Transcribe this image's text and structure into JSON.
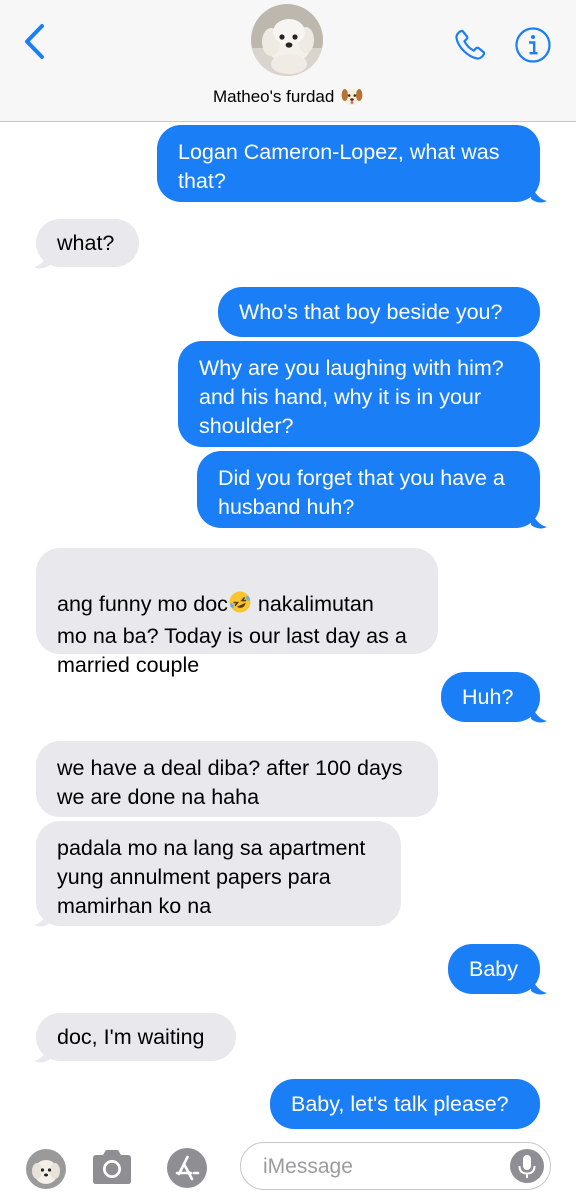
{
  "header": {
    "contact_name": "Matheo's furdad",
    "contact_emoji": "puppy-face-emoji",
    "back_icon": "chevron-left-icon",
    "call_icon": "phone-icon",
    "info_icon": "info-icon"
  },
  "messages": [
    {
      "from": "me",
      "text": "Logan Cameron-Lopez, what was\nthat?"
    },
    {
      "from": "them",
      "text": "what?"
    },
    {
      "from": "me",
      "text": "Who's that boy beside you?"
    },
    {
      "from": "me",
      "text": "Why are you laughing with him?\nand his hand, why it is in your\nshoulder?"
    },
    {
      "from": "me",
      "text": "Did you forget that you have a\nhusband huh?"
    },
    {
      "from": "them",
      "text_before_emoji": "ang funny mo doc",
      "emoji": "rolling-laughing-emoji",
      "text_after_emoji": " nakalimutan\nmo na ba? Today is our last day as a\nmarried couple"
    },
    {
      "from": "me",
      "text": "Huh?"
    },
    {
      "from": "them",
      "text": "we have a deal diba? after 100 days\nwe are done na haha"
    },
    {
      "from": "them",
      "text": "padala mo na lang sa apartment\nyung annulment papers para\nmamirhan ko na"
    },
    {
      "from": "me",
      "text": "Baby"
    },
    {
      "from": "them",
      "text": "doc, I'm waiting"
    },
    {
      "from": "me",
      "text": "Baby, let's talk please?"
    }
  ],
  "composer": {
    "placeholder": "iMessage",
    "value": "",
    "camera_icon": "camera-icon",
    "apps_icon": "app-store-icon",
    "mic_icon": "microphone-icon"
  },
  "colors": {
    "sent_bubble": "#1a7ff7",
    "received_bubble": "#e8e8ed",
    "accent": "#1a7ff7"
  }
}
